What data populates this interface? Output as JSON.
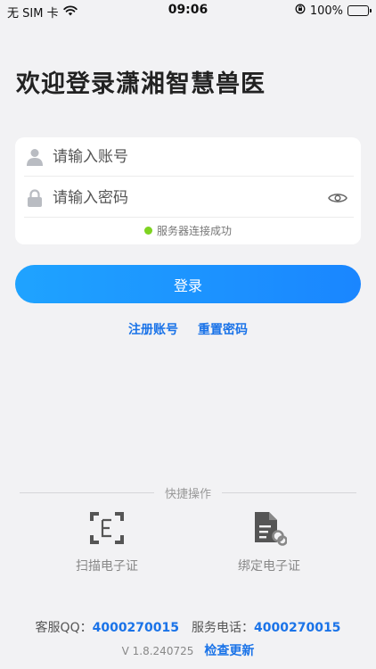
{
  "status_bar": {
    "carrier": "无 SIM 卡",
    "time": "09:06",
    "battery": "100%"
  },
  "title": "欢迎登录潇湘智慧兽医",
  "form": {
    "account_placeholder": "请输入账号",
    "password_placeholder": "请输入密码",
    "server_status": "服务器连接成功",
    "status_color": "#7ed321"
  },
  "login_label": "登录",
  "links": {
    "register": "注册账号",
    "reset": "重置密码"
  },
  "quick": {
    "heading": "快捷操作",
    "scan_label": "扫描电子证",
    "scan_icon": "scan-e-icon",
    "bind_label": "绑定电子证",
    "bind_icon": "document-link-icon"
  },
  "contact": {
    "qq_label": "客服QQ：",
    "qq": "4000270015",
    "phone_label": "服务电话：",
    "phone": "4000270015"
  },
  "version": {
    "text": "V 1.8.240725",
    "update": "检查更新"
  },
  "colors": {
    "accent": "#1a73e8",
    "button": "#1a8cff"
  }
}
